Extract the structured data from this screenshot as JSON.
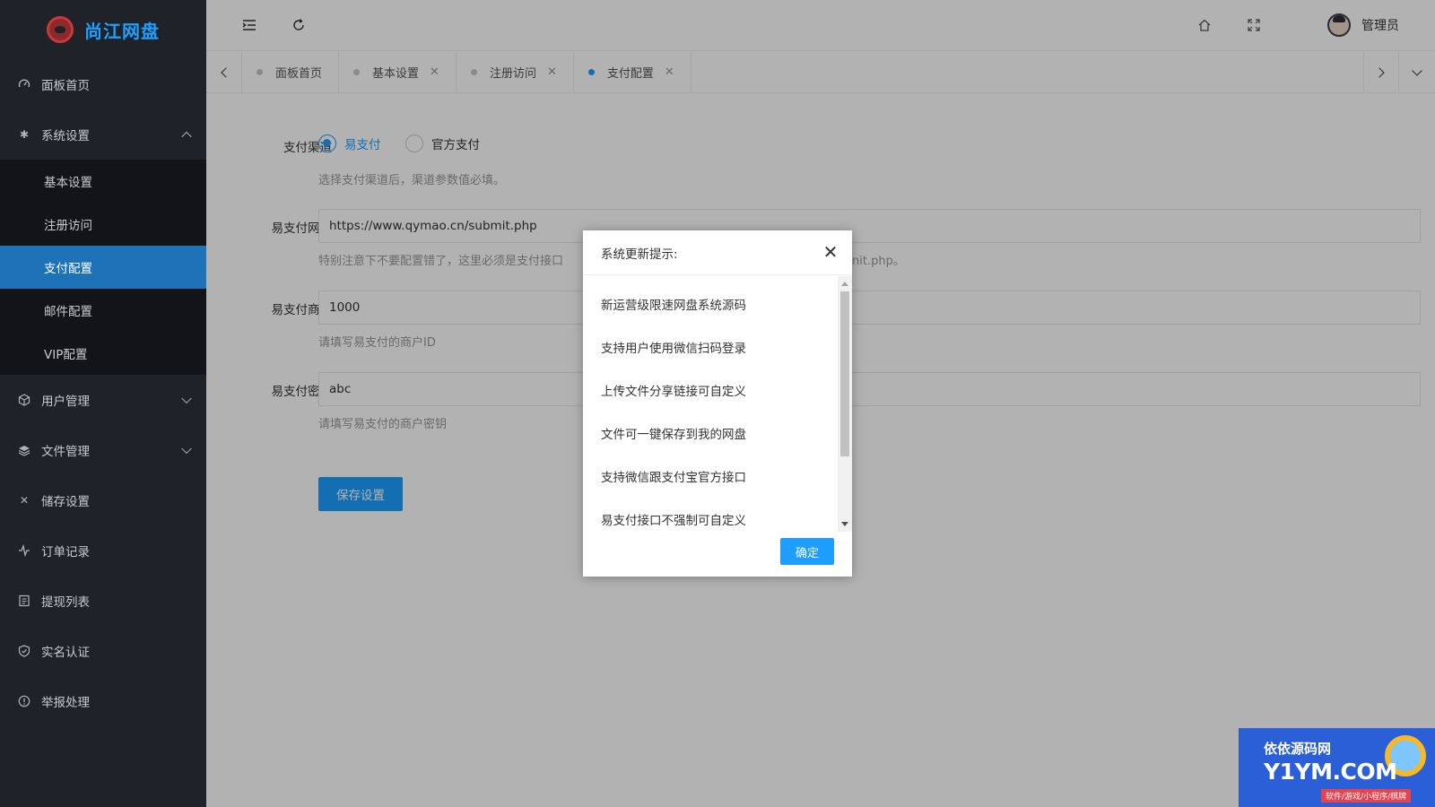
{
  "app": {
    "title": "尚江网盘"
  },
  "sidebar": {
    "items": [
      {
        "label": "面板首页",
        "icon": "dashboard-icon"
      },
      {
        "label": "系统设置",
        "icon": "gear-icon",
        "expanded": true,
        "children": [
          {
            "label": "基本设置"
          },
          {
            "label": "注册访问"
          },
          {
            "label": "支付配置",
            "active": true
          },
          {
            "label": "邮件配置"
          },
          {
            "label": "VIP配置"
          }
        ]
      },
      {
        "label": "用户管理",
        "icon": "cube-icon",
        "expanded": false
      },
      {
        "label": "文件管理",
        "icon": "layers-icon",
        "expanded": false
      },
      {
        "label": "储存设置",
        "icon": "tools-icon"
      },
      {
        "label": "订单记录",
        "icon": "pulse-icon"
      },
      {
        "label": "提现列表",
        "icon": "list-icon"
      },
      {
        "label": "实名认证",
        "icon": "shield-check-icon"
      },
      {
        "label": "举报处理",
        "icon": "info-icon"
      }
    ]
  },
  "header": {
    "user_name": "管理员"
  },
  "tabs": [
    {
      "label": "面板首页",
      "closable": false
    },
    {
      "label": "基本设置",
      "closable": true
    },
    {
      "label": "注册访问",
      "closable": true
    },
    {
      "label": "支付配置",
      "closable": true,
      "active": true
    }
  ],
  "form": {
    "channel": {
      "label": "支付渠道",
      "options": [
        "易支付",
        "官方支付"
      ],
      "selected": "易支付",
      "hint": "选择支付渠道后，渠道参数值必填。"
    },
    "gateway": {
      "label": "易支付网关",
      "value": "https://www.qymao.cn/submit.php",
      "hint_left": "特别注意下不要配置错了，这里必须是支付接口",
      "hint_right": "nit.php。"
    },
    "merchant": {
      "label": "易支付商户",
      "value": "1000",
      "hint": "请填写易支付的商户ID"
    },
    "secret": {
      "label": "易支付密钥",
      "value": "abc",
      "hint": "请填写易支付的商户密钥"
    },
    "save_label": "保存设置"
  },
  "dialog": {
    "title": "系统更新提示:",
    "lines": [
      "新运营级限速网盘系统源码",
      "支持用户使用微信扫码登录",
      "上传文件分享链接可自定义",
      "文件可一键保存到我的网盘",
      "支持微信跟支付宝官方接口",
      "易支付接口不强制可自定义"
    ],
    "ok_label": "确定"
  },
  "watermark": {
    "line1": "依依源码网",
    "line2": "Y1YM.COM",
    "line3": "软件/游戏/小程序/棋牌"
  },
  "colors": {
    "accent": "#1e9fff",
    "sidebar_bg": "#20222a",
    "sidebar_active": "#1e73b8"
  }
}
